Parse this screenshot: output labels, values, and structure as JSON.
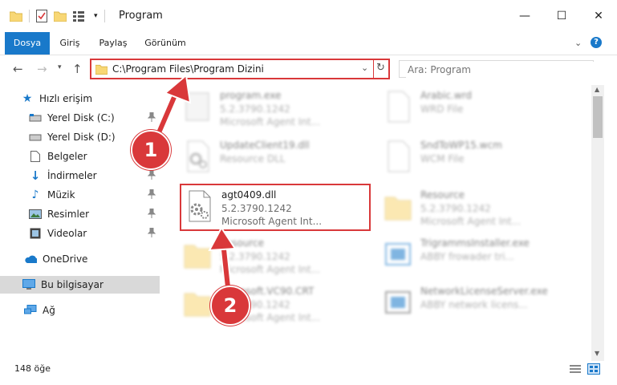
{
  "window": {
    "title": "Program",
    "minimize": "—",
    "maximize": "☐",
    "close": "✕"
  },
  "ribbon": {
    "tabs": [
      {
        "label": "Dosya"
      },
      {
        "label": "Giriş"
      },
      {
        "label": "Paylaş"
      },
      {
        "label": "Görünüm"
      }
    ],
    "help": "?"
  },
  "navbar": {
    "back": "←",
    "forward": "→",
    "up": "↑",
    "address_path": "C:\\Program Files\\Program Dizini",
    "search_placeholder": "Ara: Program"
  },
  "sidebar": {
    "items": [
      {
        "label": "Hızlı erişim"
      },
      {
        "label": "Yerel Disk (C:)"
      },
      {
        "label": "Yerel Disk (D:)"
      },
      {
        "label": "Belgeler"
      },
      {
        "label": "İndirmeler"
      },
      {
        "label": "Müzik"
      },
      {
        "label": "Resimler"
      },
      {
        "label": "Videolar"
      },
      {
        "label": "OneDrive"
      },
      {
        "label": "Bu bilgisayar"
      },
      {
        "label": "Ağ"
      }
    ]
  },
  "files": [
    {
      "name": "program.exe",
      "line2": "5.2.3790.1242",
      "line3": "Microsoft Agent Int..."
    },
    {
      "name": "Arabic.wrd",
      "line2": "WRD File",
      "line3": ""
    },
    {
      "name": "UpdateClient19.dll",
      "line2": "Resource DLL",
      "line3": ""
    },
    {
      "name": "SndToWP15.wcm",
      "line2": "WCM File",
      "line3": ""
    },
    {
      "name": "agt0409.dll",
      "line2": "5.2.3790.1242",
      "line3": "Microsoft Agent Int..."
    },
    {
      "name": "Resource",
      "line2": "5.2.3790.1242",
      "line3": "Microsoft Agent Int..."
    },
    {
      "name": "Resource",
      "line2": "5.2.3790.1242",
      "line3": "Microsoft Agent Int..."
    },
    {
      "name": "TrigrammsInstaller.exe",
      "line2": "ABBY frowader tri...",
      "line3": ""
    },
    {
      "name": "Microsoft.VC90.CRT",
      "line2": "5.2.3790.1242",
      "line3": "Microsoft Agent Int..."
    },
    {
      "name": "NetworkLicenseServer.exe",
      "line2": "ABBY network licens...",
      "line3": ""
    }
  ],
  "statusbar": {
    "count": "148 öğe"
  },
  "callouts": {
    "one": "1",
    "two": "2"
  }
}
